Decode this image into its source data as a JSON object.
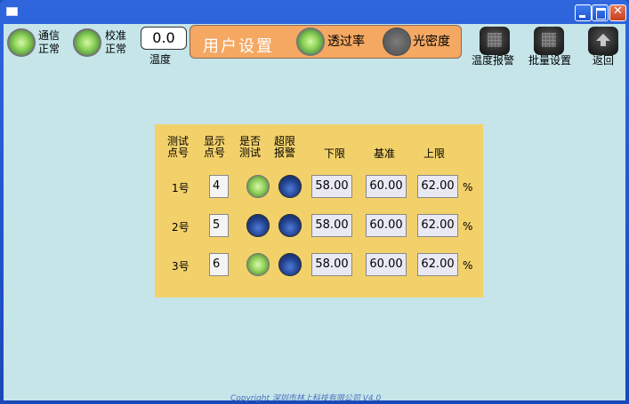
{
  "status": {
    "comm": {
      "label_line1": "通信",
      "label_line2": "正常",
      "state": "green"
    },
    "calib": {
      "label_line1": "校准",
      "label_line2": "正常",
      "state": "green"
    },
    "temperature": {
      "value": "0.0",
      "label": "温度"
    }
  },
  "user_settings": {
    "title": "用户设置",
    "transmittance": {
      "label": "透过率",
      "state": "green"
    },
    "optical_density": {
      "label": "光密度",
      "state": "gray"
    }
  },
  "toolbar": {
    "temp_alarm": "温度报警",
    "batch_settings": "批量设置",
    "back": "返回"
  },
  "table": {
    "headers": {
      "point_no": [
        "测试",
        "点号"
      ],
      "display_no": [
        "显示",
        "点号"
      ],
      "is_test": [
        "是否",
        "测试"
      ],
      "over_alarm": [
        "超限",
        "报警"
      ],
      "lower": "下限",
      "base": "基准",
      "upper": "上限"
    },
    "unit": "%",
    "rows": [
      {
        "point": "1号",
        "display": "4",
        "test_state": "green",
        "alarm_state": "blue",
        "lower": "58.00",
        "base": "60.00",
        "upper": "62.00"
      },
      {
        "point": "2号",
        "display": "5",
        "test_state": "blue",
        "alarm_state": "blue",
        "lower": "58.00",
        "base": "60.00",
        "upper": "62.00"
      },
      {
        "point": "3号",
        "display": "6",
        "test_state": "green",
        "alarm_state": "blue",
        "lower": "58.00",
        "base": "60.00",
        "upper": "62.00"
      }
    ]
  },
  "footer": "Copyright 深圳市林上科技有限公司 V4.0"
}
